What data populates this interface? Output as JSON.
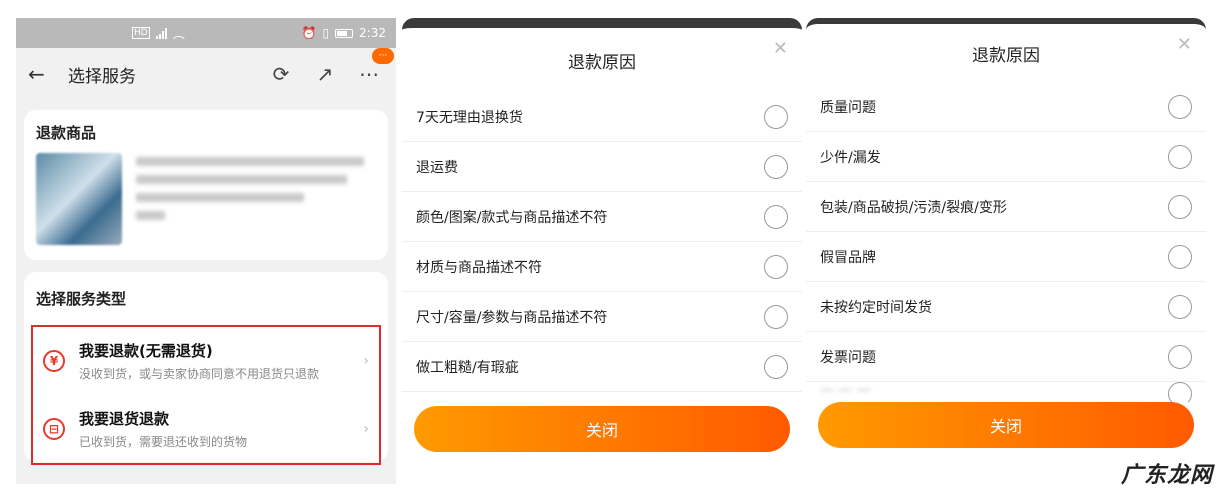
{
  "panel1": {
    "status": {
      "time": "2:32"
    },
    "nav": {
      "title": "选择服务",
      "back_icon": "←",
      "refresh_icon": "⟳",
      "share_icon": "↗",
      "more_icon": "⋯",
      "badge": "···"
    },
    "goods": {
      "heading": "退款商品"
    },
    "service": {
      "heading": "选择服务类型",
      "options": [
        {
          "title": "我要退款(无需退货)",
          "desc": "没收到货，或与卖家协商同意不用退货只退款",
          "icon": "¥"
        },
        {
          "title": "我要退货退款",
          "desc": "已收到货，需要退还收到的货物",
          "icon": "⊟"
        }
      ]
    }
  },
  "panel2": {
    "title": "退款原因",
    "reasons": [
      "7天无理由退换货",
      "退运费",
      "颜色/图案/款式与商品描述不符",
      "材质与商品描述不符",
      "尺寸/容量/参数与商品描述不符",
      "做工粗糙/有瑕疵"
    ],
    "close": "关闭"
  },
  "panel3": {
    "title": "退款原因",
    "reasons": [
      "质量问题",
      "少件/漏发",
      "包装/商品破损/污渍/裂痕/变形",
      "假冒品牌",
      "未按约定时间发货",
      "发票问题"
    ],
    "close": "关闭"
  },
  "watermark": "广东龙网",
  "colors": {
    "accent": "#ff6a00",
    "highlight": "#e02b2b"
  }
}
